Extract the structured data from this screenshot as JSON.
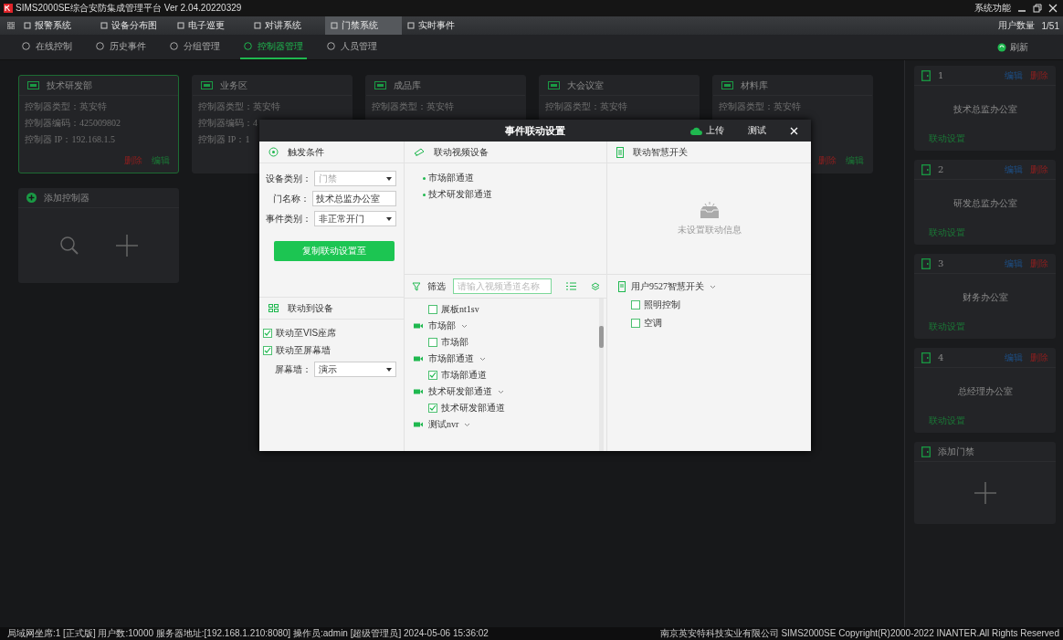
{
  "window": {
    "title": "SIMS2000SE综合安防集成管理平台  Ver 2.04.20220329",
    "system_menu": "系统功能"
  },
  "menu": [
    {
      "label": "报警系统",
      "selected": false
    },
    {
      "label": "设备分布图",
      "selected": false
    },
    {
      "label": "电子巡更",
      "selected": false
    },
    {
      "label": "对讲系统",
      "selected": false
    },
    {
      "label": "门禁系统",
      "selected": true
    },
    {
      "label": "实时事件",
      "selected": false
    }
  ],
  "user_count": {
    "label": "用户数量",
    "value": "1/51"
  },
  "subtabs": [
    {
      "label": "在线控制",
      "selected": false
    },
    {
      "label": "历史事件",
      "selected": false
    },
    {
      "label": "分组管理",
      "selected": false
    },
    {
      "label": "控制器管理",
      "selected": true
    },
    {
      "label": "人员管理",
      "selected": false
    }
  ],
  "refresh": "刷新",
  "controllers": [
    {
      "name": "技术研发部",
      "selected": true,
      "lines": [
        "控制器类型：英安特",
        "控制器编码：425009802",
        "控制器  IP：192.168.1.5"
      ],
      "actions": [
        "删除",
        "编辑"
      ]
    },
    {
      "name": "业务区",
      "selected": false,
      "lines": [
        "控制器类型：英安特",
        "控制器编码：4",
        "控制器  IP：1"
      ]
    },
    {
      "name": "成品库",
      "selected": false,
      "lines": [
        "控制器类型：英安特"
      ]
    },
    {
      "name": "大会议室",
      "selected": false,
      "lines": [
        "控制器类型：英安特"
      ]
    },
    {
      "name": "材料库",
      "selected": false,
      "lines": [
        "控制器类型：英安特"
      ],
      "actions": [
        "删除",
        "编辑"
      ]
    }
  ],
  "add_controller": "添加控制器",
  "doors": [
    {
      "number": "1",
      "name": "技术总监办公室",
      "edit": "编辑",
      "delete": "删除",
      "link": "联动设置"
    },
    {
      "number": "2",
      "name": "研发总监办公室",
      "edit": "编辑",
      "delete": "删除",
      "link": "联动设置"
    },
    {
      "number": "3",
      "name": "财务办公室",
      "edit": "编辑",
      "delete": "删除",
      "link": "联动设置"
    },
    {
      "number": "4",
      "name": "总经理办公室",
      "edit": "编辑",
      "delete": "删除",
      "link": "联动设置"
    }
  ],
  "add_door": "添加门禁",
  "dialog": {
    "title": "事件联动设置",
    "upload": "上传",
    "test": "测试",
    "trigger": {
      "title": "触发条件",
      "fields": [
        {
          "label": "设备类别：",
          "value": "门禁",
          "kind": "select",
          "disabled": true
        },
        {
          "label": "门名称：",
          "value": "技术总监办公室",
          "kind": "text",
          "disabled": false
        },
        {
          "label": "事件类别：",
          "value": "非正常开门",
          "kind": "select",
          "disabled": false
        }
      ],
      "copy_button": "复制联动设置至"
    },
    "link_devices": {
      "title": "联动到设备",
      "options": [
        {
          "label": "联动至VIS座席",
          "checked": true
        },
        {
          "label": "联动至屏幕墙",
          "checked": true
        }
      ],
      "wall": {
        "label": "屏幕墙：",
        "value": "演示"
      }
    },
    "video": {
      "title": "联动视频设备",
      "linked": [
        "市场部通道",
        "技术研发部通道"
      ],
      "filter": "筛选",
      "placeholder": "请输入视频通道名称",
      "tree": [
        {
          "children": [
            {
              "label": "展板nt1sv",
              "checked": false
            }
          ]
        },
        {
          "label": "市场部",
          "children": [
            {
              "label": "市场部",
              "checked": false
            }
          ]
        },
        {
          "label": "市场部通道",
          "children": [
            {
              "label": "市场部通道",
              "checked": true
            }
          ]
        },
        {
          "label": "技术研发部通道",
          "children": [
            {
              "label": "技术研发部通道",
              "checked": true
            }
          ]
        },
        {
          "label": "测试nvr"
        }
      ]
    },
    "switch": {
      "title": "联动智慧开关",
      "empty": "未设置联动信息",
      "group": "用户9527智慧开关",
      "items": [
        {
          "label": "照明控制",
          "checked": false
        },
        {
          "label": "空调",
          "checked": false
        }
      ]
    }
  },
  "status": {
    "left": "局域网坐席:1 [正式版] 用户数:10000 服务器地址:[192.168.1.210:8080]   操作员:admin [超级管理员]     2024-05-06 15:36:02",
    "right": "南京英安特科技实业有限公司   SIMS2000SE Copyright(R)2000-2022 INANTER.All Rights Reserved"
  }
}
